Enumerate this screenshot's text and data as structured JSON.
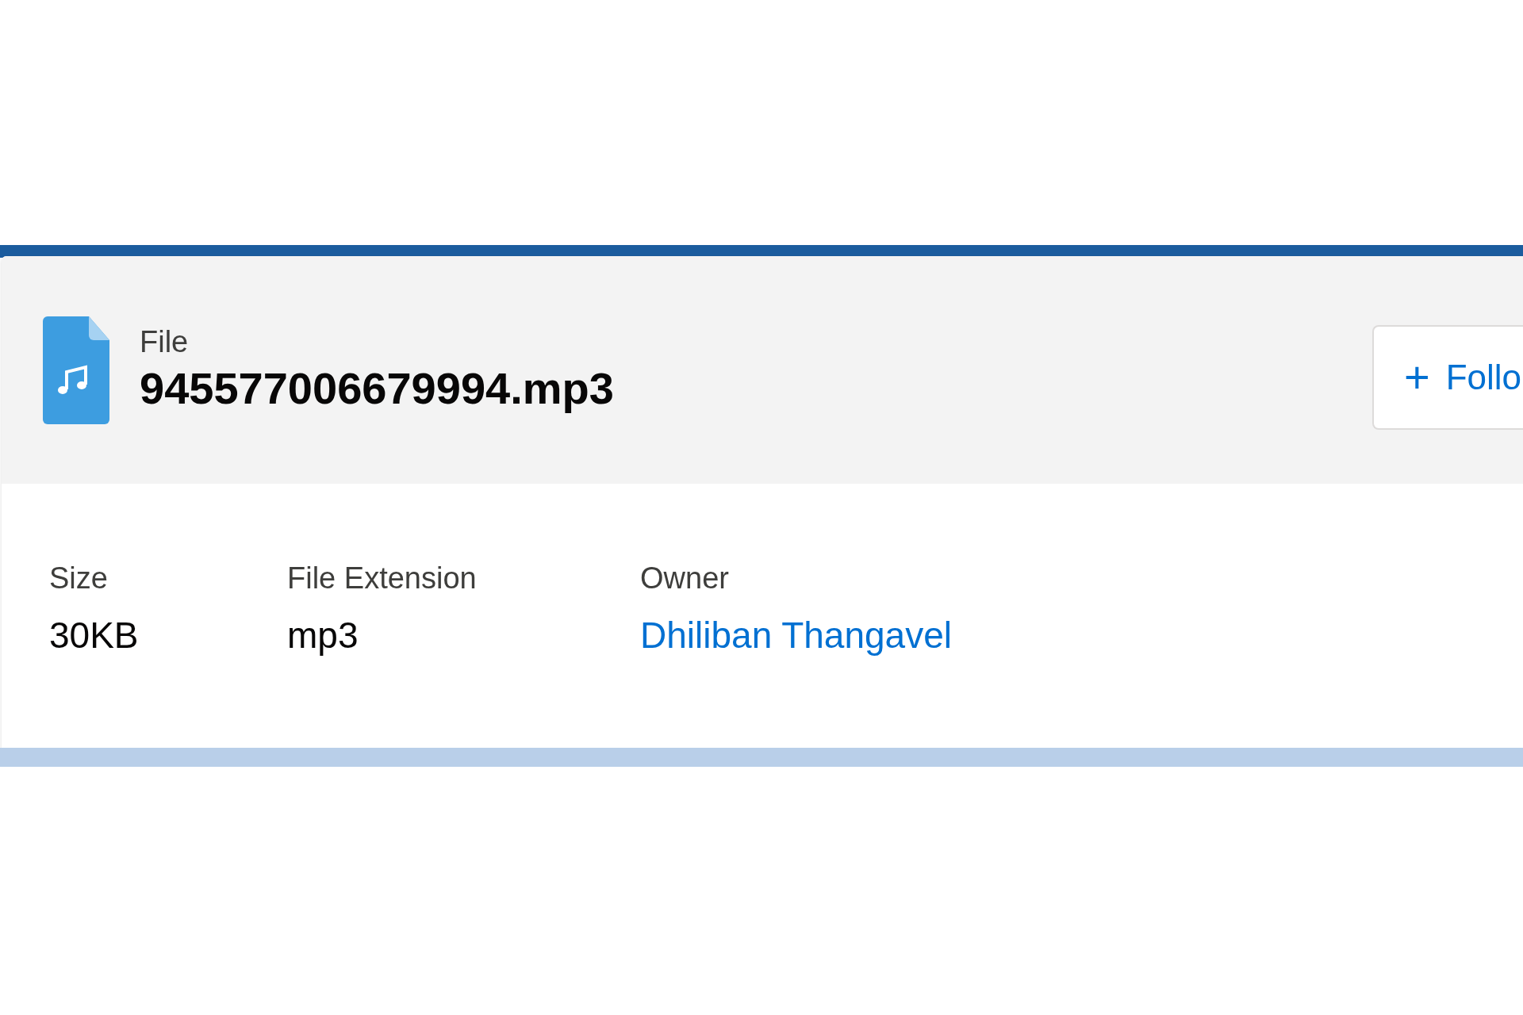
{
  "header": {
    "object_type": "File",
    "title": "945577006679994.mp3",
    "follow_button": {
      "icon": "+",
      "label": "Follo"
    }
  },
  "fields": [
    {
      "label": "Size",
      "value": "30KB",
      "kind": "text"
    },
    {
      "label": "File Extension",
      "value": "mp3",
      "kind": "text"
    },
    {
      "label": "Owner",
      "value": "Dhiliban Thangavel",
      "kind": "link"
    }
  ]
}
